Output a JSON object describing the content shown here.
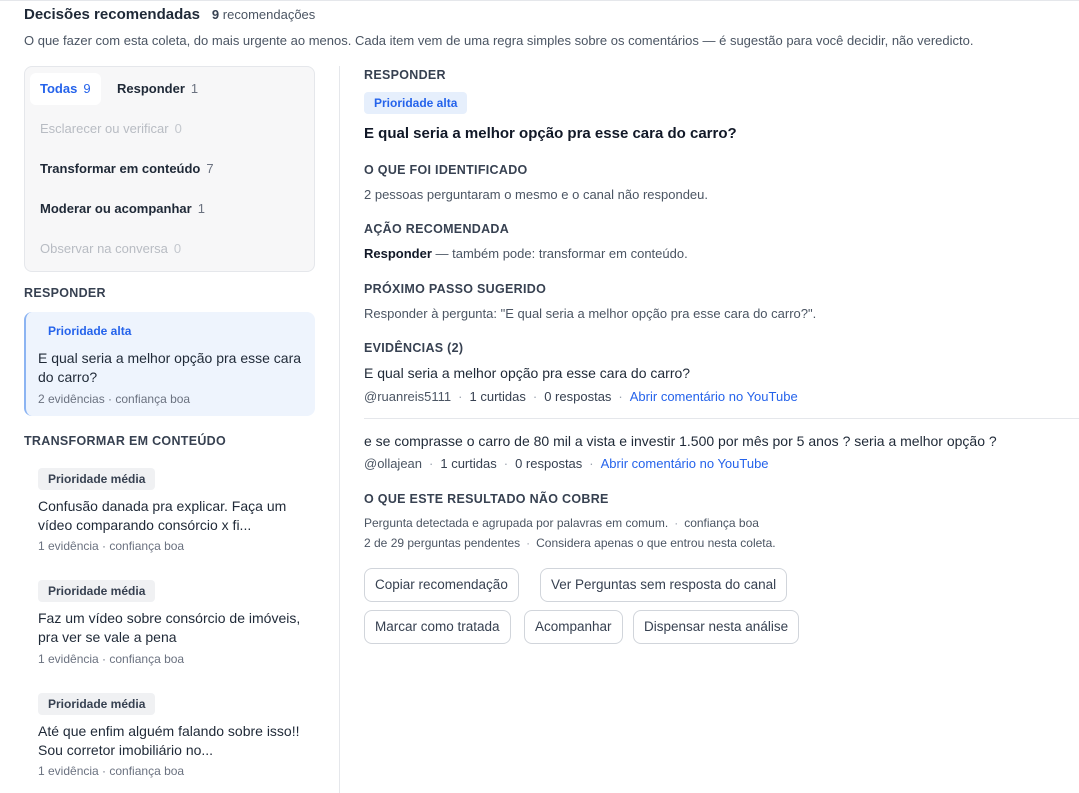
{
  "header": {
    "title": "Decisões recomendadas",
    "count": "9",
    "count_label": "recomendações",
    "subtitle": "O que fazer com esta coleta, do mais urgente ao menos. Cada item vem de uma regra simples sobre os comentários — é sugestão para você decidir, não veredicto."
  },
  "filters": [
    {
      "label": "Todas",
      "count": "9",
      "state": "active"
    },
    {
      "label": "Responder",
      "count": "1",
      "state": "normal"
    },
    {
      "label": "Esclarecer ou verificar",
      "count": "0",
      "state": "disabled"
    },
    {
      "label": "Transformar em conteúdo",
      "count": "7",
      "state": "normal"
    },
    {
      "label": "Moderar ou acompanhar",
      "count": "1",
      "state": "normal"
    },
    {
      "label": "Observar na conversa",
      "count": "0",
      "state": "disabled"
    }
  ],
  "sections": [
    {
      "label": "RESPONDER",
      "items": [
        {
          "priority": "Prioridade alta",
          "title": "E qual seria a melhor opção pra esse cara do carro?",
          "meta": "2 evidências · confiança boa"
        }
      ]
    },
    {
      "label": "TRANSFORMAR EM CONTEÚDO",
      "items": [
        {
          "priority": "Prioridade média",
          "title": "Confusão danada pra explicar. Faça um vídeo comparando consórcio x fi...",
          "meta": "1 evidência · confiança boa"
        },
        {
          "priority": "Prioridade média",
          "title": "Faz um vídeo sobre consórcio de imóveis, pra ver se vale a pena",
          "meta": "1 evidência · confiança boa"
        },
        {
          "priority": "Prioridade média",
          "title": "Até que enfim alguém falando sobre isso!! Sou corretor imobiliário no...",
          "meta": "1 evidência · confiança boa"
        }
      ]
    }
  ],
  "detail": {
    "category": "RESPONDER",
    "priority": "Prioridade alta",
    "title": "E qual seria a melhor opção pra esse cara do carro?",
    "identified_heading": "O QUE FOI IDENTIFICADO",
    "identified_text": "2 pessoas perguntaram o mesmo e o canal não respondeu.",
    "action_heading": "AÇÃO RECOMENDADA",
    "action_main": "Responder",
    "action_rest": " — também pode: transformar em conteúdo.",
    "next_heading": "PRÓXIMO PASSO SUGERIDO",
    "next_text": "Responder à pergunta: \"E qual seria a melhor opção pra esse cara do carro?\".",
    "evidence_heading": "EVIDÊNCIAS (2)",
    "evidence": [
      {
        "text": "E qual seria a melhor opção pra esse cara do carro?",
        "author": "@ruanreis5111",
        "likes": "1 curtidas",
        "replies": "0 respostas",
        "link": "Abrir comentário no YouTube"
      },
      {
        "text": "e se comprasse o carro de 80 mil a vista e investir 1.500 por mês por 5 anos ? seria a melhor opção ?",
        "author": "@ollajean",
        "likes": "1 curtidas",
        "replies": "0 respostas",
        "link": "Abrir comentário no YouTube"
      }
    ],
    "coverage_heading": "O QUE ESTE RESULTADO NÃO COBRE",
    "coverage_line1_a": "Pergunta detectada e agrupada por palavras em comum.",
    "coverage_line1_b": "confiança boa",
    "coverage_line2_a": "2 de 29 perguntas pendentes",
    "coverage_line2_b": "Considera apenas o que entrou nesta coleta.",
    "separator": "·"
  },
  "actions": {
    "copy": "Copiar recomendação",
    "view_questions": "Ver Perguntas sem resposta do canal",
    "mark_done": "Marcar como tratada",
    "follow": "Acompanhar",
    "dismiss": "Dispensar nesta análise"
  },
  "colors": {
    "accent": "#2563eb",
    "selected_bg": "#eef4fd",
    "badge_high_bg": "#e6effc"
  }
}
